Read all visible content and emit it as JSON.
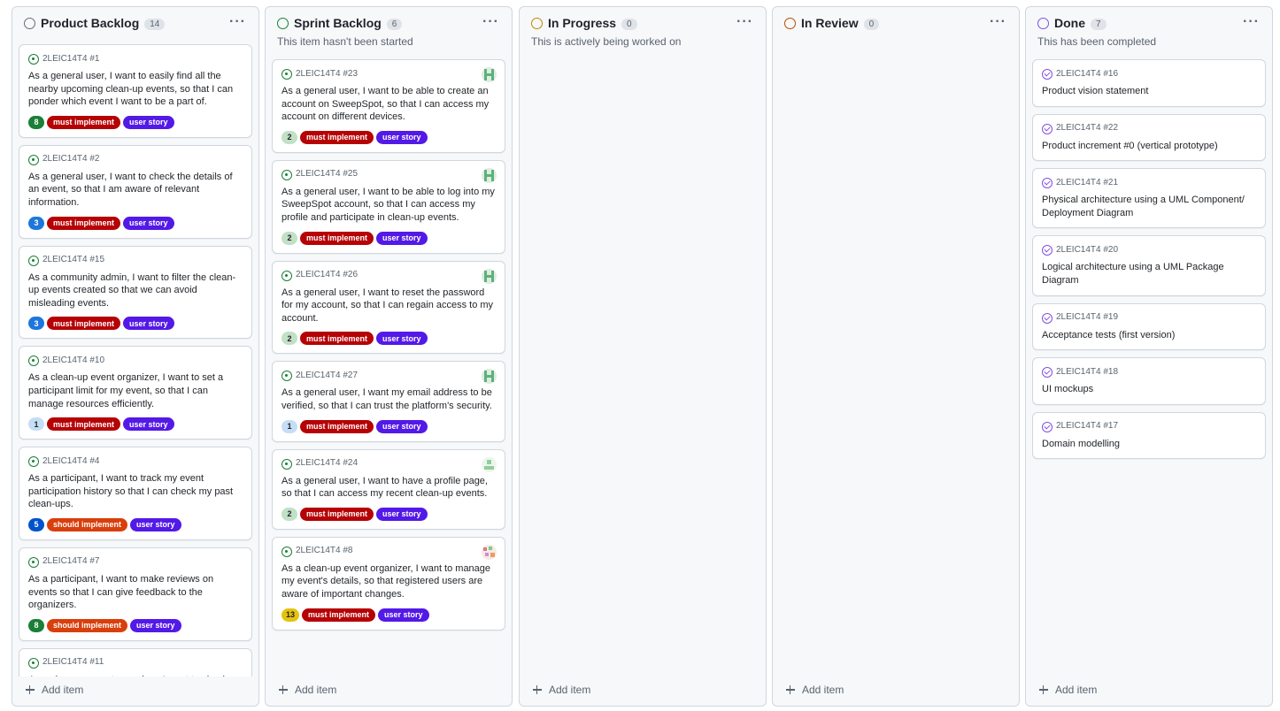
{
  "columns": [
    {
      "title": "Product Backlog",
      "count": "14",
      "status_color": "#656d76",
      "description": "",
      "add_label": "Add item",
      "cards": [
        {
          "ref": "2LEIC14T4 #1",
          "title": "As a general user, I want to easily find all the nearby upcoming clean-up events, so that I can ponder which event I want to be a part of.",
          "avatar": "",
          "labels": [
            {
              "text": "8",
              "color": "#1a7f37",
              "type": "points"
            },
            {
              "text": "must implement",
              "color": "#b60205"
            },
            {
              "text": "user story",
              "color": "#5319e7"
            }
          ]
        },
        {
          "ref": "2LEIC14T4 #2",
          "title": "As a general user, I want to check the details of an event, so that I am aware of relevant information.",
          "avatar": "",
          "labels": [
            {
              "text": "3",
              "color": "#1d76db",
              "type": "points"
            },
            {
              "text": "must implement",
              "color": "#b60205"
            },
            {
              "text": "user story",
              "color": "#5319e7"
            }
          ]
        },
        {
          "ref": "2LEIC14T4 #15",
          "title": "As a community admin, I want to filter the clean-up events created so that we can avoid misleading events.",
          "avatar": "",
          "labels": [
            {
              "text": "3",
              "color": "#1d76db",
              "type": "points"
            },
            {
              "text": "must implement",
              "color": "#b60205"
            },
            {
              "text": "user story",
              "color": "#5319e7"
            }
          ]
        },
        {
          "ref": "2LEIC14T4 #10",
          "title": "As a clean-up event organizer, I want to set a participant limit for my event, so that I can manage resources efficiently.",
          "avatar": "",
          "labels": [
            {
              "text": "1",
              "color": "#c5def5",
              "text_color": "#1f2328",
              "type": "points"
            },
            {
              "text": "must implement",
              "color": "#b60205"
            },
            {
              "text": "user story",
              "color": "#5319e7"
            }
          ]
        },
        {
          "ref": "2LEIC14T4 #4",
          "title": "As a participant, I want to track my event participation history so that I can check my past clean-ups.",
          "avatar": "",
          "labels": [
            {
              "text": "5",
              "color": "#0052cc",
              "type": "points"
            },
            {
              "text": "should implement",
              "color": "#d93f0b"
            },
            {
              "text": "user story",
              "color": "#5319e7"
            }
          ]
        },
        {
          "ref": "2LEIC14T4 #7",
          "title": "As a participant, I want to make reviews on events so that I can give feedback to the organizers.",
          "avatar": "",
          "labels": [
            {
              "text": "8",
              "color": "#1a7f37",
              "type": "points"
            },
            {
              "text": "should implement",
              "color": "#d93f0b"
            },
            {
              "text": "user story",
              "color": "#5319e7"
            }
          ]
        },
        {
          "ref": "2LEIC14T4 #11",
          "title": "As a clean-up event organizer, I want to check",
          "avatar": "",
          "labels": []
        }
      ]
    },
    {
      "title": "Sprint Backlog",
      "count": "6",
      "status_color": "#1a7f37",
      "description": "This item hasn't been started",
      "add_label": "Add item",
      "cards": [
        {
          "ref": "2LEIC14T4 #23",
          "title": "As a general user, I want to be able to create an account on SweepSpot, so that I can access my account on different devices.",
          "avatar": "green",
          "labels": [
            {
              "text": "2",
              "color": "#c2e0c6",
              "text_color": "#1f2328",
              "type": "points"
            },
            {
              "text": "must implement",
              "color": "#b60205"
            },
            {
              "text": "user story",
              "color": "#5319e7"
            }
          ]
        },
        {
          "ref": "2LEIC14T4 #25",
          "title": "As a general user, I want to be able to log into my SweepSpot account, so that I can access my profile and participate in clean-up events.",
          "avatar": "green",
          "labels": [
            {
              "text": "2",
              "color": "#c2e0c6",
              "text_color": "#1f2328",
              "type": "points"
            },
            {
              "text": "must implement",
              "color": "#b60205"
            },
            {
              "text": "user story",
              "color": "#5319e7"
            }
          ]
        },
        {
          "ref": "2LEIC14T4 #26",
          "title": "As a general user, I want to reset the password for my account, so that I can regain access to my account.",
          "avatar": "green",
          "labels": [
            {
              "text": "2",
              "color": "#c2e0c6",
              "text_color": "#1f2328",
              "type": "points"
            },
            {
              "text": "must implement",
              "color": "#b60205"
            },
            {
              "text": "user story",
              "color": "#5319e7"
            }
          ]
        },
        {
          "ref": "2LEIC14T4 #27",
          "title": "As a general user, I want my email address to be verified, so that I can trust the platform's security.",
          "avatar": "green",
          "labels": [
            {
              "text": "1",
              "color": "#c5def5",
              "text_color": "#1f2328",
              "type": "points"
            },
            {
              "text": "must implement",
              "color": "#b60205"
            },
            {
              "text": "user story",
              "color": "#5319e7"
            }
          ]
        },
        {
          "ref": "2LEIC14T4 #24",
          "title": "As a general user, I want to have a profile page, so that I can access my recent clean-up events.",
          "avatar": "light",
          "labels": [
            {
              "text": "2",
              "color": "#c2e0c6",
              "text_color": "#1f2328",
              "type": "points"
            },
            {
              "text": "must implement",
              "color": "#b60205"
            },
            {
              "text": "user story",
              "color": "#5319e7"
            }
          ]
        },
        {
          "ref": "2LEIC14T4 #8",
          "title": "As a clean-up event organizer, I want to manage my event's details, so that registered users are aware of important changes.",
          "avatar": "multi",
          "labels": [
            {
              "text": "13",
              "color": "#e4c30e",
              "text_color": "#1f2328",
              "type": "points"
            },
            {
              "text": "must implement",
              "color": "#b60205"
            },
            {
              "text": "user story",
              "color": "#5319e7"
            }
          ]
        }
      ]
    },
    {
      "title": "In Progress",
      "count": "0",
      "status_color": "#bf8700",
      "description": "This is actively being worked on",
      "add_label": "Add item",
      "cards": []
    },
    {
      "title": "In Review",
      "count": "0",
      "status_color": "#bc4c00",
      "description": "",
      "add_label": "Add item",
      "cards": []
    },
    {
      "title": "Done",
      "count": "7",
      "status_color": "#8250df",
      "description": "This has been completed",
      "add_label": "Add item",
      "cards": [
        {
          "ref": "2LEIC14T4 #16",
          "title": "Product vision statement",
          "avatar": "",
          "done": true,
          "labels": []
        },
        {
          "ref": "2LEIC14T4 #22",
          "title": "Product increment #0 (vertical prototype)",
          "avatar": "",
          "done": true,
          "labels": []
        },
        {
          "ref": "2LEIC14T4 #21",
          "title": "Physical architecture using a UML Component/ Deployment Diagram",
          "avatar": "",
          "done": true,
          "labels": []
        },
        {
          "ref": "2LEIC14T4 #20",
          "title": "Logical architecture using a UML Package Diagram",
          "avatar": "",
          "done": true,
          "labels": []
        },
        {
          "ref": "2LEIC14T4 #19",
          "title": "Acceptance tests (first version)",
          "avatar": "",
          "done": true,
          "labels": []
        },
        {
          "ref": "2LEIC14T4 #18",
          "title": "UI mockups",
          "avatar": "",
          "done": true,
          "labels": []
        },
        {
          "ref": "2LEIC14T4 #17",
          "title": "Domain modelling",
          "avatar": "",
          "done": true,
          "labels": []
        }
      ]
    }
  ]
}
